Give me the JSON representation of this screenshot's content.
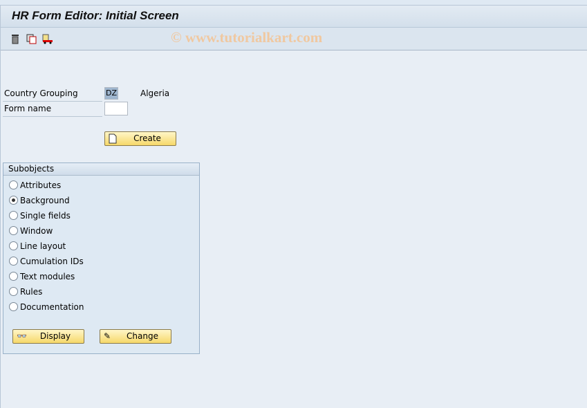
{
  "title": "HR Form Editor: Initial Screen",
  "toolbar": {
    "icons": [
      "trash-icon",
      "copy-icon",
      "transport-icon"
    ]
  },
  "watermark": "© www.tutorialkart.com",
  "fields": {
    "country_label": "Country Grouping",
    "country_value": "DZ",
    "country_text": "Algeria",
    "form_label": "Form name",
    "form_value": ""
  },
  "create_label": "Create",
  "subobjects": {
    "title": "Subobjects",
    "selected": "Background",
    "options": [
      "Attributes",
      "Background",
      "Single fields",
      "Window",
      "Line layout",
      "Cumulation IDs",
      "Text modules",
      "Rules",
      "Documentation"
    ]
  },
  "display_label": "Display",
  "change_label": "Change"
}
